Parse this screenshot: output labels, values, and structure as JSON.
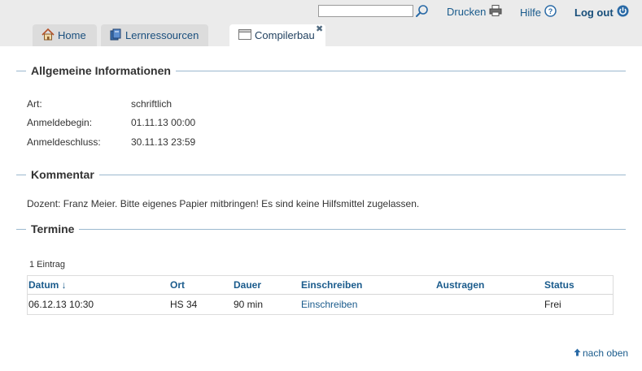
{
  "header": {
    "search_value": "",
    "print_label": "Drucken",
    "help_label": "Hilfe",
    "logout_label": "Log out"
  },
  "tabs": [
    {
      "label": "Home",
      "icon": "home-icon"
    },
    {
      "label": "Lernressourcen",
      "icon": "books-icon"
    },
    {
      "label": "Compilerbau",
      "icon": "window-icon",
      "active": true
    }
  ],
  "general": {
    "title": "Allgemeine Informationen",
    "fields": [
      {
        "label": "Art:",
        "value": "schriftlich"
      },
      {
        "label": "Anmeldebegin:",
        "value": "01.11.13 00:00"
      },
      {
        "label": "Anmeldeschluss:",
        "value": "30.11.13 23:59"
      }
    ]
  },
  "comment": {
    "title": "Kommentar",
    "text": "Dozent: Franz Meier. Bitte eigenes Papier mitbringen! Es sind keine Hilfsmittel zugelassen."
  },
  "termine": {
    "title": "Termine",
    "count": "1 Eintrag",
    "columns": [
      "Datum ↓",
      "Ort",
      "Dauer",
      "Einschreiben",
      "Austragen",
      "Status"
    ],
    "rows": [
      {
        "datum": "06.12.13 10:30",
        "ort": "HS 34",
        "dauer": "90 min",
        "einschreiben": "Einschreiben",
        "austragen": "",
        "status": "Frei"
      }
    ]
  },
  "footer": {
    "back_to_top": "nach oben"
  },
  "colors": {
    "link": "#1a5b8c",
    "header_bg": "#ebebeb",
    "tab_bg": "#dcdcdc",
    "rule": "#9bb8cf"
  }
}
